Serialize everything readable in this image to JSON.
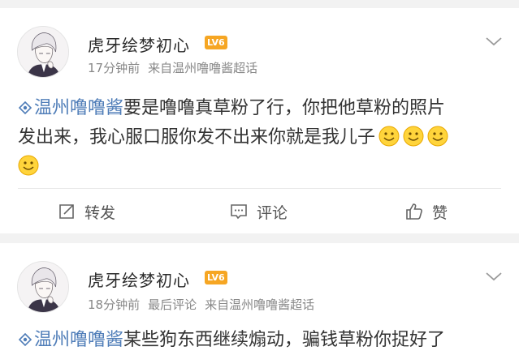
{
  "posts": [
    {
      "username": "虎牙绘梦初心",
      "level_badge": "LV6",
      "time": "17分钟前",
      "source": "来自温州噜噜酱超话",
      "topic": "温州噜噜酱",
      "text_line1": "要是噜噜真草粉了行，你把他草粉的照片",
      "text_line2": "发出来，我心服口服你发不出来你就是我儿子",
      "emoji_count": 4,
      "actions": {
        "repost": "转发",
        "comment": "评论",
        "like": "赞"
      }
    },
    {
      "username": "虎牙绘梦初心",
      "level_badge": "LV6",
      "time": "18分钟前",
      "extra": "最后评论",
      "source": "来自温州噜噜酱超话",
      "topic": "温州噜噜酱",
      "text_line1": "某些狗东西继续煽动，骗钱草粉你捉好了"
    }
  ],
  "colors": {
    "topic_link": "#4f7db8",
    "level_badge": "#f6a623",
    "meta_text": "#888888",
    "page_bg": "#f2f2f2"
  }
}
